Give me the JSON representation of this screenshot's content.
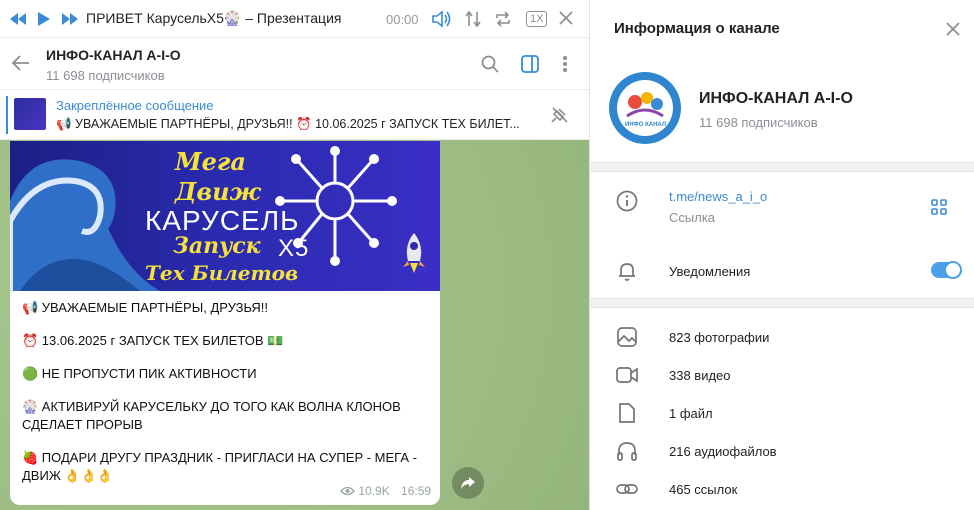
{
  "player": {
    "title": "ПРИВЕТ КарусельХ5🎡 – Презентация",
    "time": "00:00",
    "speed": "1X"
  },
  "chat": {
    "name": "ИНФО-КАНАЛ A-I-O",
    "subscribers": "11 698 подписчиков"
  },
  "pinned": {
    "title": "Закреплённое сообщение",
    "text": "📢 УВАЖАЕМЫЕ ПАРТНЁРЫ, ДРУЗЬЯ!! ⏰ 10.06.2025 г ЗАПУСК ТЕХ БИЛЕТ..."
  },
  "banner": {
    "line1": "Мега",
    "line2": "Движ",
    "brand": "КАРУСЕЛЬ",
    "brand_suffix": "X5",
    "line3": "Запуск",
    "line4": "Тех Билетов"
  },
  "message": {
    "lines": [
      "📢 УВАЖАЕМЫЕ ПАРТНЁРЫ, ДРУЗЬЯ!!",
      "⏰ 13.06.2025 г ЗАПУСК ТЕХ БИЛЕТОВ 💵",
      "🟢 НЕ ПРОПУСТИ ПИК АКТИВНОСТИ",
      "🎡 АКТИВИРУЙ КАРУСЕЛЬКУ ДО ТОГО КАК ВОЛНА КЛОНОВ СДЕЛАЕТ ПРОРЫВ",
      "🍓 ПОДАРИ ДРУГУ ПРАЗДНИК - ПРИГЛАСИ НА СУПЕР - МЕГА - ДВИЖ 👌👌👌"
    ],
    "views": "10.9K",
    "time": "16:59"
  },
  "info": {
    "header": "Информация о канале",
    "channel_name": "ИНФО-КАНАЛ A-I-O",
    "subscribers": "11 698 подписчиков",
    "logo_caption": "ИНФО КАНАЛ",
    "link": "t.me/news_a_i_o",
    "link_label": "Ссылка",
    "notifications": "Уведомления",
    "notifications_on": true,
    "media": [
      {
        "icon": "photo-icon",
        "label": "823 фотографии"
      },
      {
        "icon": "video-icon",
        "label": "338 видео"
      },
      {
        "icon": "file-icon",
        "label": "1 файл"
      },
      {
        "icon": "headphones-icon",
        "label": "216 аудиофайлов"
      },
      {
        "icon": "link-icon",
        "label": "465 ссылок"
      }
    ]
  }
}
